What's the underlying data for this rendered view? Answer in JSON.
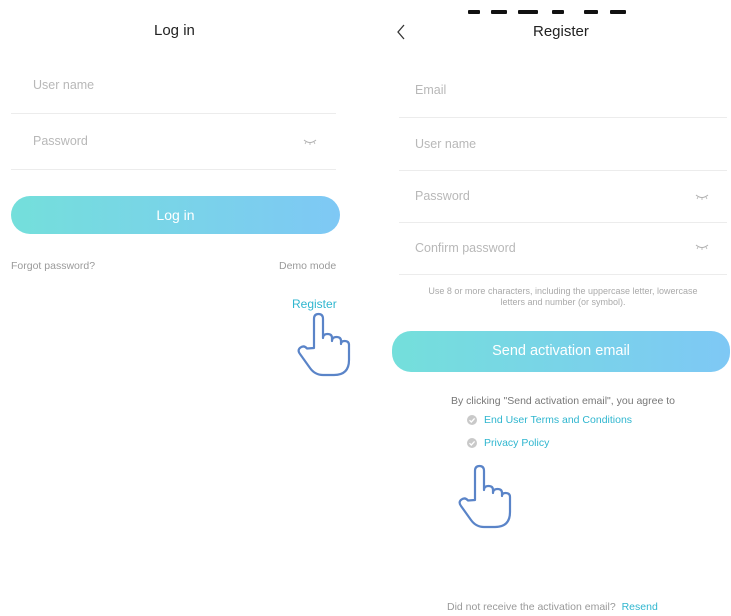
{
  "login": {
    "title": "Log in",
    "username_placeholder": "User name",
    "password_placeholder": "Password",
    "login_button": "Log in",
    "forgot_password": "Forgot password?",
    "demo_mode": "Demo mode",
    "register_link": "Register"
  },
  "register": {
    "back_glyph": "<",
    "title": "Register",
    "email_placeholder": "Email",
    "username_placeholder": "User name",
    "password_placeholder": "Password",
    "confirm_password_placeholder": "Confirm password",
    "password_hint_line1": "Use 8 or more characters, including the uppercase letter, lowercase",
    "password_hint_line2": "letters and number (or symbol).",
    "send_button": "Send activation email",
    "agree_text": "By clicking \"Send activation email\", you agree to",
    "terms_link": "End User Terms and Conditions",
    "privacy_link": "Privacy Policy",
    "not_received": "Did not receive the activation email?",
    "resend_link": "Resend"
  },
  "colors": {
    "accent": "#2fb6cf",
    "button_gradient_start": "#74dfdb",
    "button_gradient_end": "#7ec8f5",
    "hand_stroke": "#5a84c8"
  },
  "icons": {
    "password_visibility": "eye-closed-icon",
    "back": "chevron-left-icon",
    "pointer": "hand-pointer-icon",
    "checkmark": "check-circle-icon"
  }
}
